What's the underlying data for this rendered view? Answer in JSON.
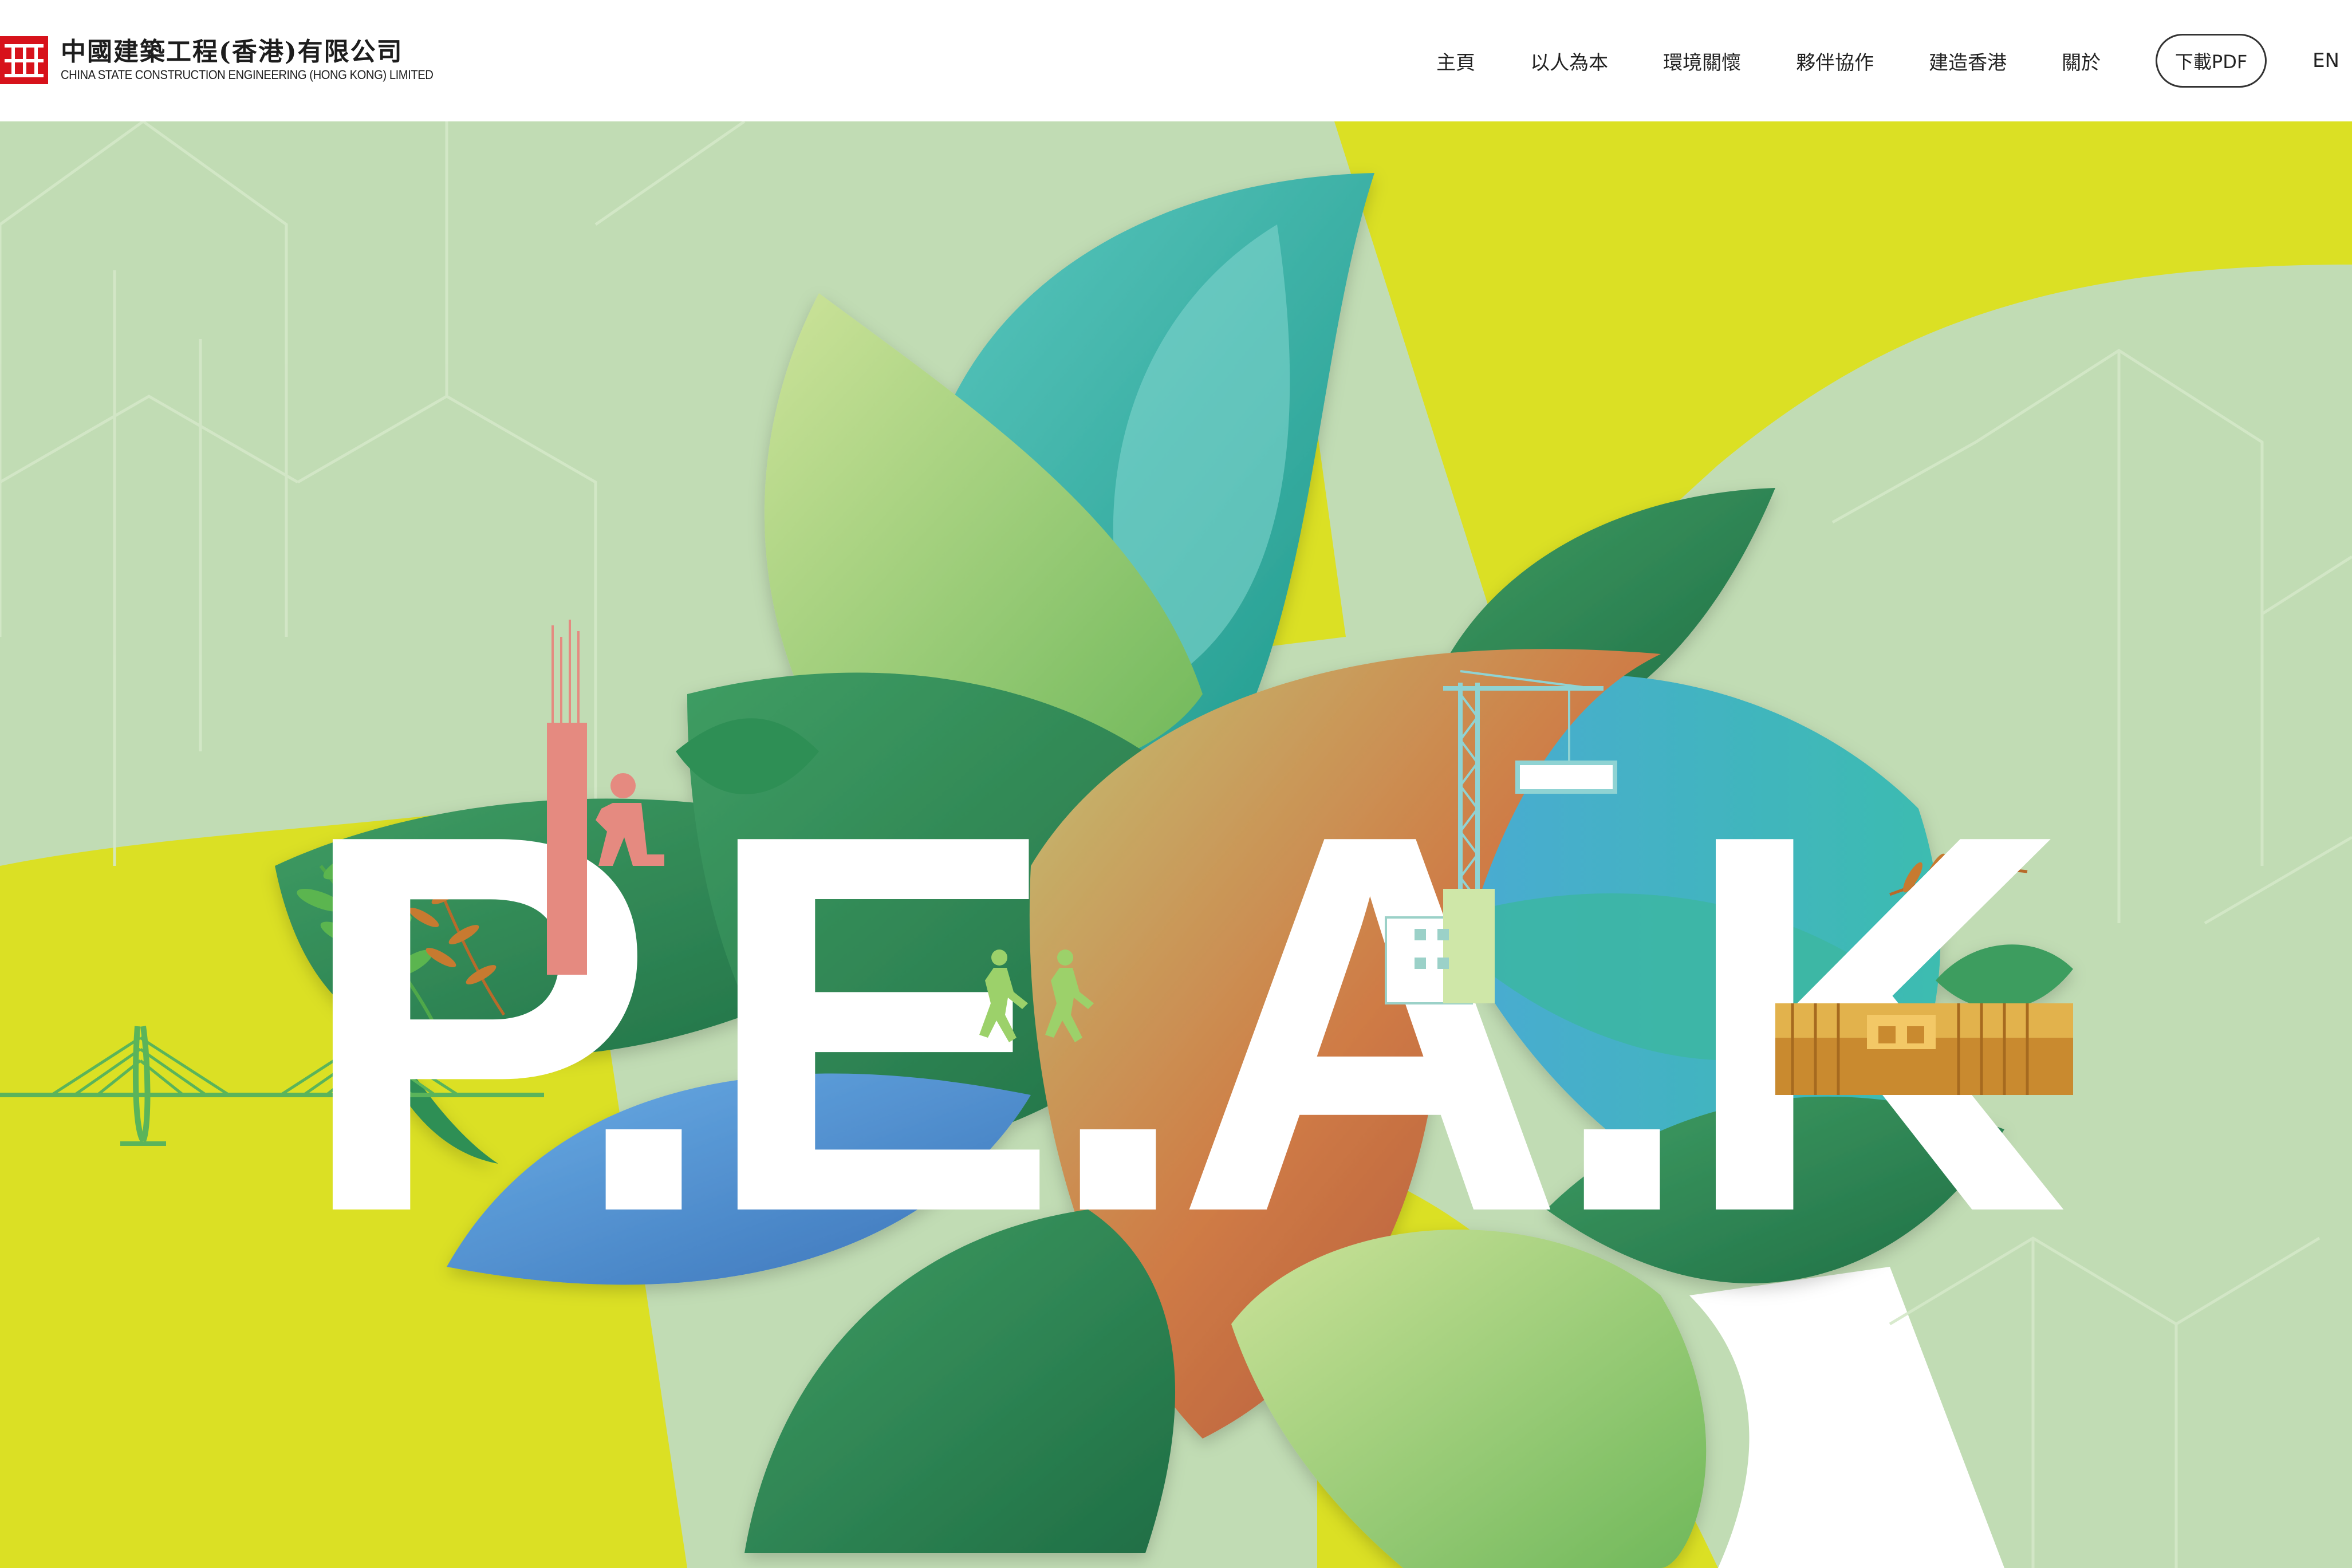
{
  "header": {
    "logo": {
      "name_cn": "中國建築工程(香港)有限公司",
      "name_en": "CHINA STATE CONSTRUCTION ENGINEERING (HONG KONG) LIMITED",
      "brand_color": "#d7121b"
    },
    "nav": {
      "items": [
        {
          "label": "主頁"
        },
        {
          "label": "以人為本"
        },
        {
          "label": "環境關懷"
        },
        {
          "label": "夥伴協作"
        },
        {
          "label": "建造香港"
        },
        {
          "label": "關於"
        }
      ],
      "pdf_label": "下載PDF",
      "lang_label": "EN"
    }
  },
  "hero": {
    "title": "P.E.A.K",
    "colors": {
      "background_green": "#c1dcb4",
      "background_yellow": "#dbe024",
      "leaf_dark_green": "#2e8b57",
      "leaf_teal": "#3cb7b0",
      "leaf_light_green": "#9dcd6e",
      "leaf_blue": "#4f8fd0",
      "leaf_orange": "#c7663a",
      "title_color": "#ffffff"
    },
    "icons": [
      "bridge-icon",
      "crane-icon",
      "runner-icon",
      "worker-icon",
      "fern-icon"
    ]
  }
}
